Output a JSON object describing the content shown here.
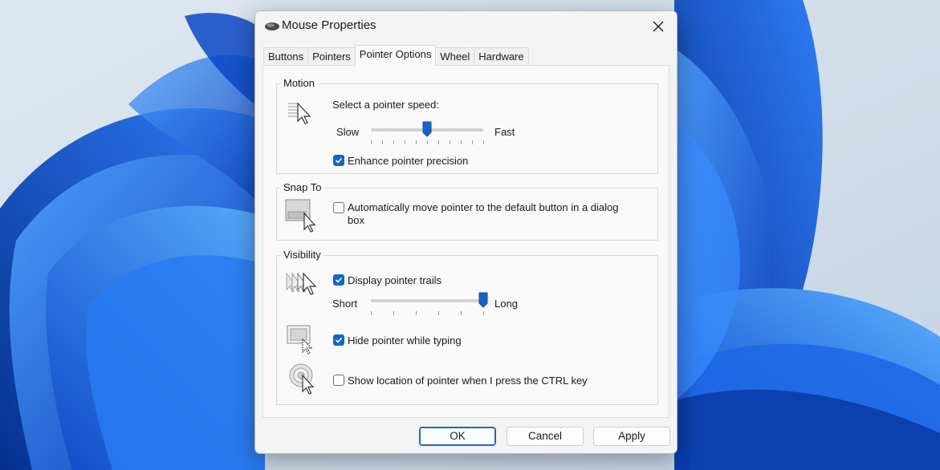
{
  "window": {
    "title": "Mouse Properties",
    "close_icon": "close-icon"
  },
  "tabs": [
    {
      "label": "Buttons",
      "active": false
    },
    {
      "label": "Pointers",
      "active": false
    },
    {
      "label": "Pointer Options",
      "active": true
    },
    {
      "label": "Wheel",
      "active": false
    },
    {
      "label": "Hardware",
      "active": false
    }
  ],
  "motion": {
    "legend": "Motion",
    "speed_label": "Select a pointer speed:",
    "slow_label": "Slow",
    "fast_label": "Fast",
    "speed_value": 0.5,
    "precision_label": "Enhance pointer precision",
    "precision_checked": true
  },
  "snap_to": {
    "legend": "Snap To",
    "auto_move_label_line1": "Automatically move pointer to the default button in a dialog",
    "auto_move_label_line2": "box",
    "auto_move_checked": false
  },
  "visibility": {
    "legend": "Visibility",
    "trails_label": "Display pointer trails",
    "trails_checked": true,
    "short_label": "Short",
    "long_label": "Long",
    "trails_value": 1.0,
    "hide_label": "Hide pointer while typing",
    "hide_checked": true,
    "ctrl_label": "Show location of pointer when I press the CTRL key",
    "ctrl_checked": false
  },
  "buttons": {
    "ok": "OK",
    "cancel": "Cancel",
    "apply": "Apply"
  },
  "colors": {
    "accent": "#1565c8",
    "wallpaper_blue": "#1a5fe0"
  }
}
